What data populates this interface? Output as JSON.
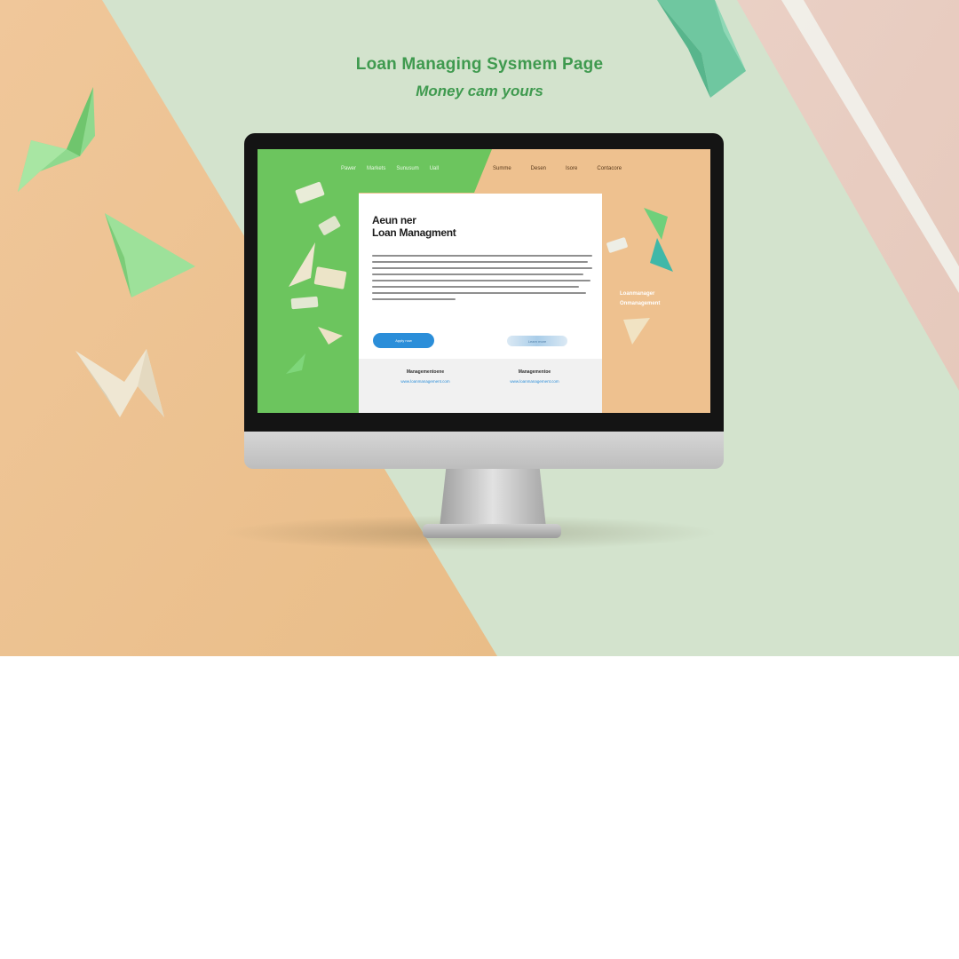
{
  "hero": {
    "headline": "Loan Managing Sysmem Page",
    "subheadline": "Money cam yours"
  },
  "site": {
    "nav_left": [
      "Pawer",
      "Markets",
      "Sunusum",
      "Uall"
    ],
    "nav_right": [
      "Summe",
      "Desen",
      "Isore",
      "Contacore"
    ],
    "card": {
      "title_line1": "Aeun ner",
      "title_line2": "Loan Managment",
      "primary_button": "Apply now",
      "secondary_button": "Learn more",
      "footer": [
        {
          "label": "Managementoene",
          "link": "www.loanmanagement.com"
        },
        {
          "label": "Managementoe",
          "link": "www.loanmanagement.com"
        }
      ]
    },
    "side_caption_line1": "Loanmanager",
    "side_caption_line2": "Onmanagement"
  },
  "colors": {
    "headline": "#3f9a4f",
    "screen_green": "#6cc55e",
    "screen_peach": "#eec18f",
    "primary_button": "#2b8ed9",
    "scene_peach": "#eec393",
    "scene_mint": "#d5e4cf"
  },
  "icons": [
    "origami-bird-icon",
    "paper-plane-icon",
    "money-note-icon",
    "origami-crane-icon"
  ]
}
